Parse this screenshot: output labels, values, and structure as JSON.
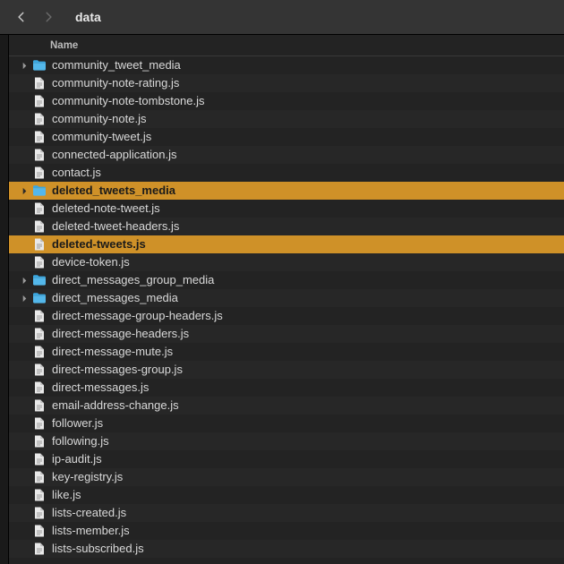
{
  "header": {
    "title": "data",
    "column_label": "Name"
  },
  "rows": [
    {
      "kind": "folder",
      "expandable": true,
      "selected": false,
      "name": "community_tweet_media"
    },
    {
      "kind": "file",
      "expandable": false,
      "selected": false,
      "name": "community-note-rating.js"
    },
    {
      "kind": "file",
      "expandable": false,
      "selected": false,
      "name": "community-note-tombstone.js"
    },
    {
      "kind": "file",
      "expandable": false,
      "selected": false,
      "name": "community-note.js"
    },
    {
      "kind": "file",
      "expandable": false,
      "selected": false,
      "name": "community-tweet.js"
    },
    {
      "kind": "file",
      "expandable": false,
      "selected": false,
      "name": "connected-application.js"
    },
    {
      "kind": "file",
      "expandable": false,
      "selected": false,
      "name": "contact.js"
    },
    {
      "kind": "folder",
      "expandable": true,
      "selected": true,
      "name": "deleted_tweets_media"
    },
    {
      "kind": "file",
      "expandable": false,
      "selected": false,
      "name": "deleted-note-tweet.js"
    },
    {
      "kind": "file",
      "expandable": false,
      "selected": false,
      "name": "deleted-tweet-headers.js"
    },
    {
      "kind": "file",
      "expandable": false,
      "selected": true,
      "name": "deleted-tweets.js"
    },
    {
      "kind": "file",
      "expandable": false,
      "selected": false,
      "name": "device-token.js"
    },
    {
      "kind": "folder",
      "expandable": true,
      "selected": false,
      "name": "direct_messages_group_media"
    },
    {
      "kind": "folder",
      "expandable": true,
      "selected": false,
      "name": "direct_messages_media"
    },
    {
      "kind": "file",
      "expandable": false,
      "selected": false,
      "name": "direct-message-group-headers.js"
    },
    {
      "kind": "file",
      "expandable": false,
      "selected": false,
      "name": "direct-message-headers.js"
    },
    {
      "kind": "file",
      "expandable": false,
      "selected": false,
      "name": "direct-message-mute.js"
    },
    {
      "kind": "file",
      "expandable": false,
      "selected": false,
      "name": "direct-messages-group.js"
    },
    {
      "kind": "file",
      "expandable": false,
      "selected": false,
      "name": "direct-messages.js"
    },
    {
      "kind": "file",
      "expandable": false,
      "selected": false,
      "name": "email-address-change.js"
    },
    {
      "kind": "file",
      "expandable": false,
      "selected": false,
      "name": "follower.js"
    },
    {
      "kind": "file",
      "expandable": false,
      "selected": false,
      "name": "following.js"
    },
    {
      "kind": "file",
      "expandable": false,
      "selected": false,
      "name": "ip-audit.js"
    },
    {
      "kind": "file",
      "expandable": false,
      "selected": false,
      "name": "key-registry.js"
    },
    {
      "kind": "file",
      "expandable": false,
      "selected": false,
      "name": "like.js"
    },
    {
      "kind": "file",
      "expandable": false,
      "selected": false,
      "name": "lists-created.js"
    },
    {
      "kind": "file",
      "expandable": false,
      "selected": false,
      "name": "lists-member.js"
    },
    {
      "kind": "file",
      "expandable": false,
      "selected": false,
      "name": "lists-subscribed.js"
    }
  ]
}
